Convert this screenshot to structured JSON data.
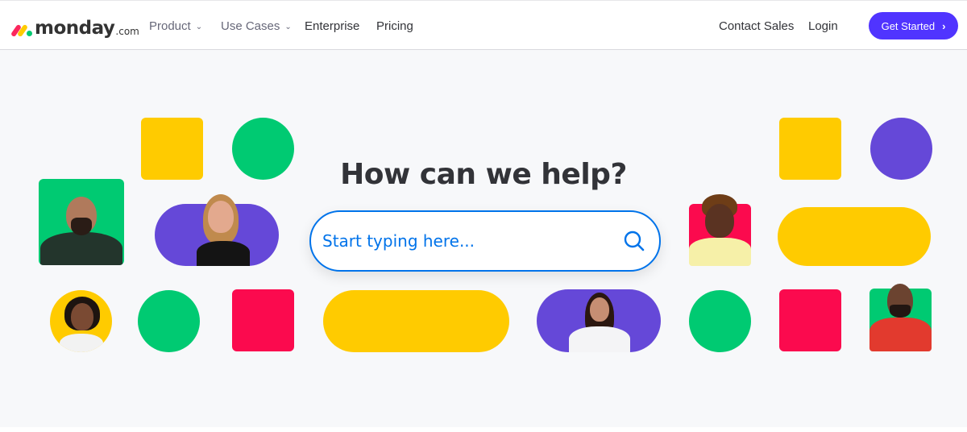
{
  "header": {
    "logo": {
      "wordmark": "monday",
      "suffix": ".com"
    },
    "nav": [
      {
        "label": "Product",
        "has_dropdown": true
      },
      {
        "label": "Use Cases",
        "has_dropdown": true
      },
      {
        "label": "Enterprise",
        "has_dropdown": false
      },
      {
        "label": "Pricing",
        "has_dropdown": false
      }
    ],
    "right_links": [
      {
        "label": "Contact Sales"
      },
      {
        "label": "Login"
      }
    ],
    "cta": {
      "label": "Get Started",
      "icon": "chevron-right-icon",
      "color": "#5034ff"
    },
    "dropdown_glyph": "⌄"
  },
  "hero": {
    "title": "How can we help?",
    "search": {
      "placeholder": "Start typing here...",
      "value": "",
      "icon": "search-icon",
      "accent": "#0073ea"
    },
    "palette": {
      "yellow": "#ffcb00",
      "green": "#00ca72",
      "purple": "#6548d8",
      "red": "#fb0a4e",
      "background": "#f7f8fa"
    }
  }
}
